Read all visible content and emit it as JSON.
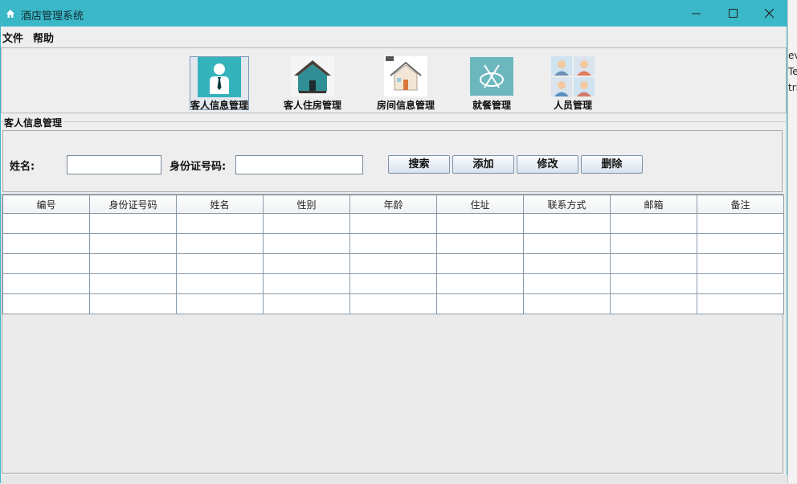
{
  "window": {
    "title": "酒店管理系统"
  },
  "menu": {
    "file": "文件",
    "help": "帮助"
  },
  "toolbar": [
    {
      "label": "客人信息管理",
      "icon": "guest-info-icon",
      "selected": true
    },
    {
      "label": "客人住房管理",
      "icon": "house-icon",
      "selected": false
    },
    {
      "label": "房间信息管理",
      "icon": "room-house-icon",
      "selected": false
    },
    {
      "label": "就餐管理",
      "icon": "dining-icon",
      "selected": false
    },
    {
      "label": "人员管理",
      "icon": "staff-icon",
      "selected": false
    }
  ],
  "section": {
    "title": "客人信息管理"
  },
  "search": {
    "name_label": "姓名:",
    "name_value": "",
    "id_label": "身份证号码:",
    "id_value": "",
    "buttons": {
      "search": "搜索",
      "add": "添加",
      "edit": "修改",
      "delete": "删除"
    }
  },
  "table": {
    "columns": [
      "编号",
      "身份证号码",
      "姓名",
      "性别",
      "年龄",
      "住址",
      "联系方式",
      "邮箱",
      "备注"
    ],
    "rows": [
      [
        "",
        "",
        "",
        "",
        "",
        "",
        "",
        "",
        ""
      ],
      [
        "",
        "",
        "",
        "",
        "",
        "",
        "",
        "",
        ""
      ],
      [
        "",
        "",
        "",
        "",
        "",
        "",
        "",
        "",
        ""
      ],
      [
        "",
        "",
        "",
        "",
        "",
        "",
        "",
        "",
        ""
      ],
      [
        "",
        "",
        "",
        "",
        "",
        "",
        "",
        "",
        ""
      ]
    ]
  },
  "background_window": {
    "fragments": [
      "ev",
      "Te",
      "tri"
    ]
  },
  "colors": {
    "titlebar": "#3bb8c8",
    "accent_teal": "#35b3bd",
    "button_border": "#7d93ab"
  }
}
